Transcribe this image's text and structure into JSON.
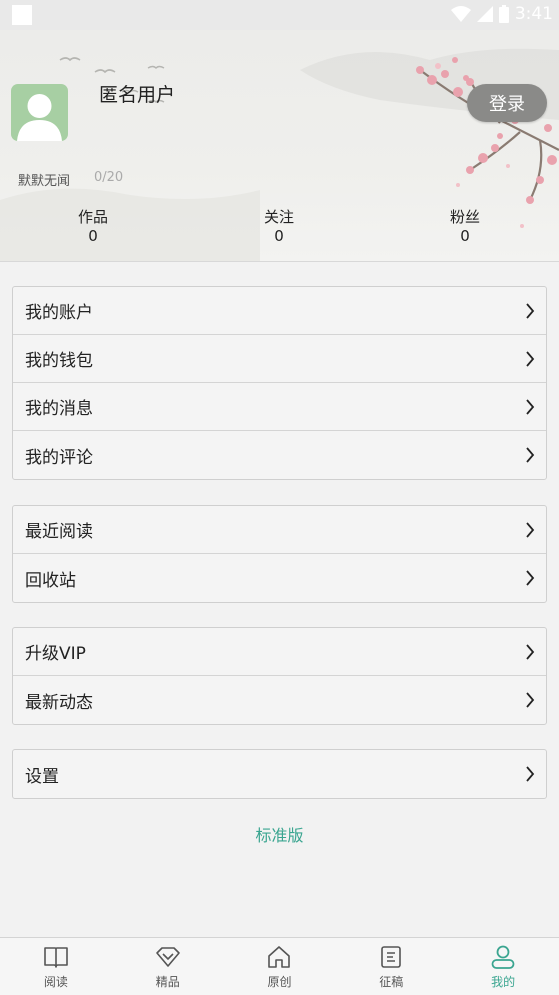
{
  "status_bar": {
    "time": "3:41"
  },
  "profile": {
    "username": "匿名用户",
    "login_label": "登录",
    "signature": "默默无闻",
    "signature_count": "0/20"
  },
  "stats": [
    {
      "label": "作品",
      "value": "0"
    },
    {
      "label": "关注",
      "value": "0"
    },
    {
      "label": "粉丝",
      "value": "0"
    }
  ],
  "menu_groups": [
    [
      "我的账户",
      "我的钱包",
      "我的消息",
      "我的评论"
    ],
    [
      "最近阅读",
      "回收站"
    ],
    [
      "升级VIP",
      "最新动态"
    ],
    [
      "设置"
    ]
  ],
  "edition": "标准版",
  "bottom_nav": [
    {
      "label": "阅读",
      "icon": "book-icon"
    },
    {
      "label": "精品",
      "icon": "diamond-icon"
    },
    {
      "label": "原创",
      "icon": "home-icon"
    },
    {
      "label": "征稿",
      "icon": "document-icon"
    },
    {
      "label": "我的",
      "icon": "user-icon"
    }
  ],
  "colors": {
    "accent": "#3aa590",
    "login_button": "#8a8a88",
    "avatar_bg": "#a7cfa3"
  }
}
